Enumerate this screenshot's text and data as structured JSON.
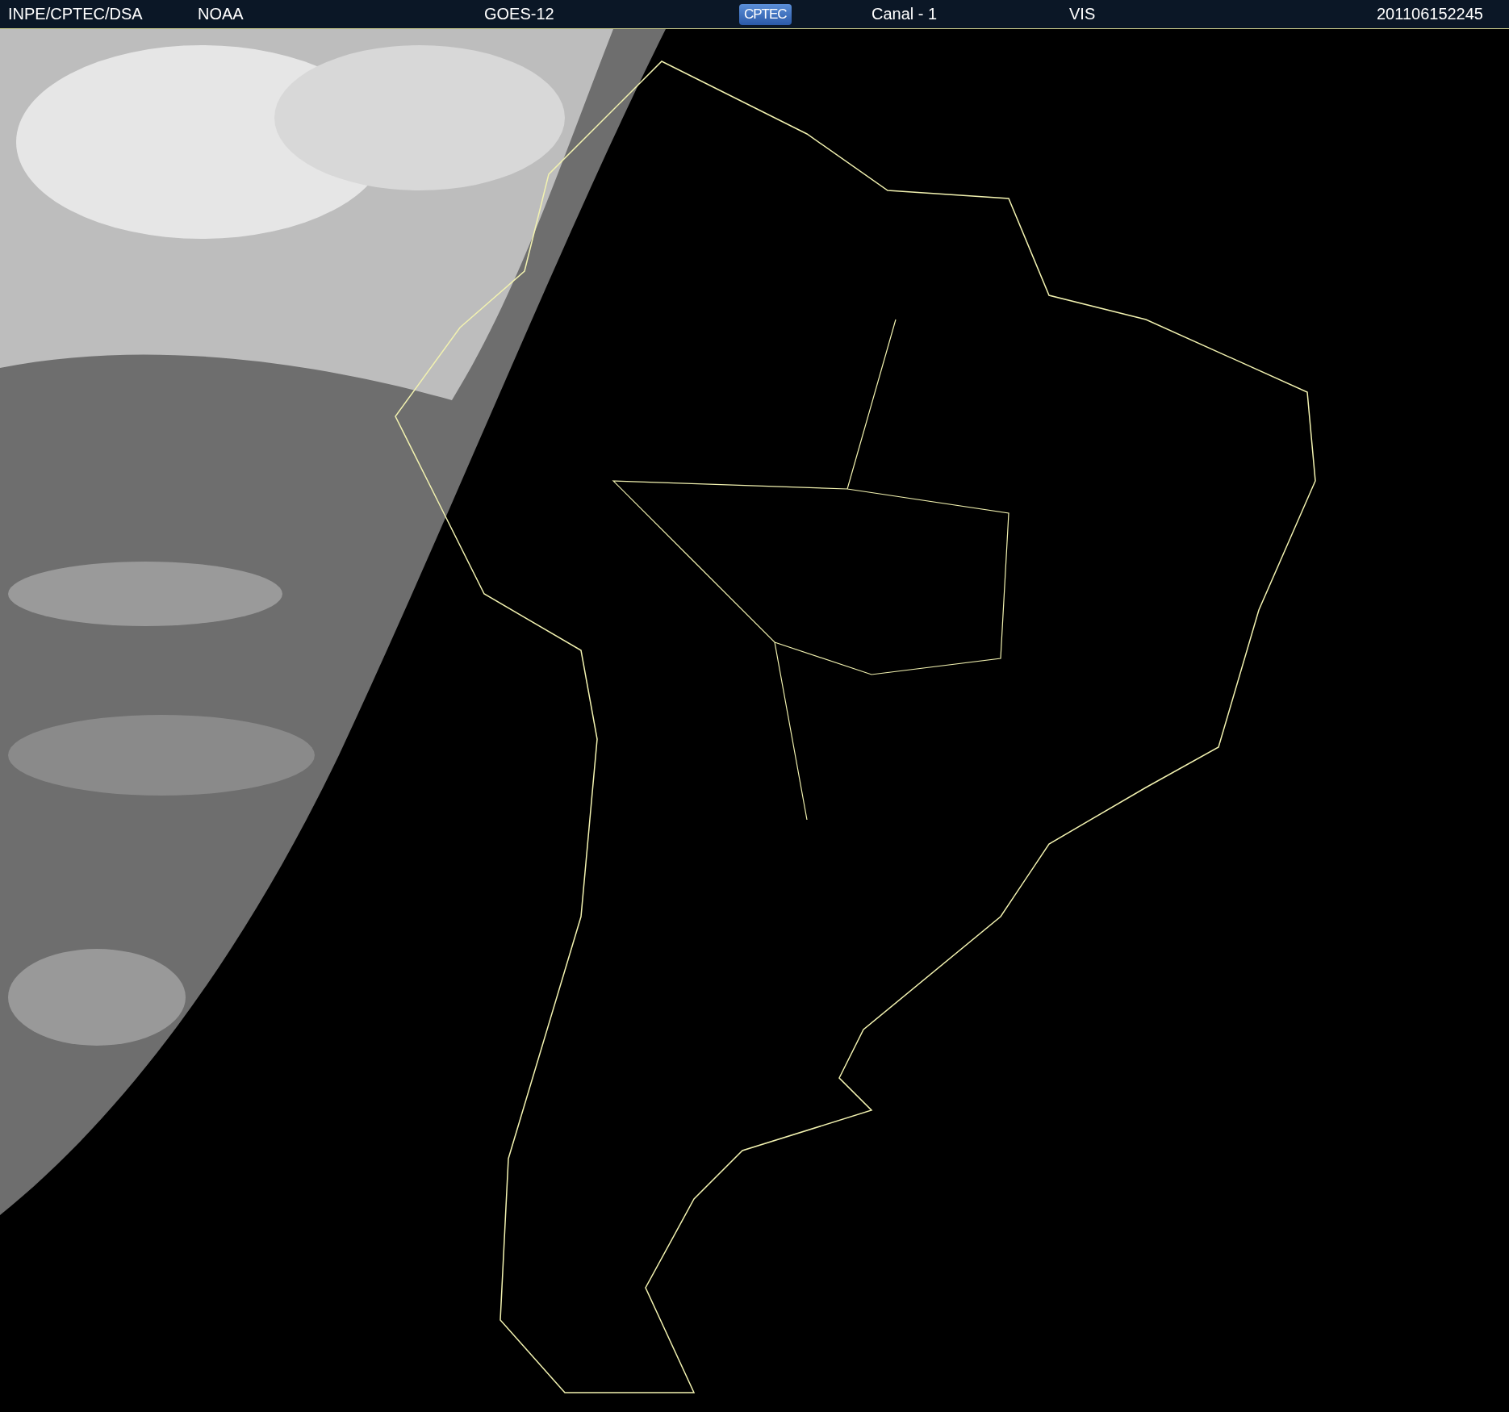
{
  "header": {
    "items": [
      {
        "kind": "text",
        "text": "INPE/CPTEC/DSA"
      },
      {
        "kind": "text",
        "text": "NOAA"
      },
      {
        "kind": "text",
        "text": "GOES-12"
      },
      {
        "kind": "logo",
        "text": "CPTEC"
      },
      {
        "kind": "text",
        "text": "Canal - 1"
      },
      {
        "kind": "text",
        "text": "VIS"
      },
      {
        "kind": "text",
        "text": "201106152245"
      }
    ]
  }
}
